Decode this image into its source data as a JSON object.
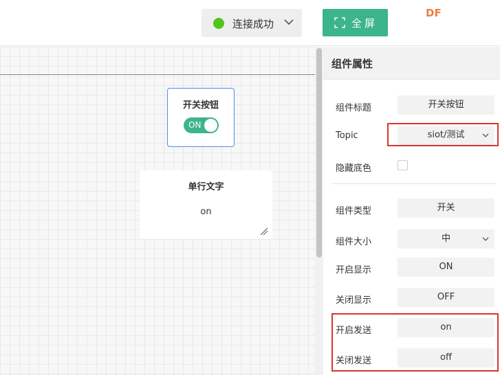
{
  "topbar": {
    "connection_label": "连接成功",
    "connection_status_color": "#52c41a",
    "fullscreen_label": "全屏",
    "brand": "DF"
  },
  "canvas": {
    "switch_widget": {
      "title": "开关按钮",
      "toggle_text": "ON",
      "state": "on"
    },
    "text_widget": {
      "title": "单行文字",
      "value": "on"
    }
  },
  "panel": {
    "title": "组件属性",
    "rows": {
      "title": {
        "label": "组件标题",
        "value": "开关按钮"
      },
      "topic": {
        "label": "Topic",
        "value": "siot/测试"
      },
      "hide_bg": {
        "label": "隐藏底色",
        "checked": false
      },
      "type": {
        "label": "组件类型",
        "value": "开关"
      },
      "size": {
        "label": "组件大小",
        "value": "中"
      },
      "on_display": {
        "label": "开启显示",
        "value": "ON"
      },
      "off_display": {
        "label": "关闭显示",
        "value": "OFF"
      },
      "on_send": {
        "label": "开启发送",
        "value": "on"
      },
      "off_send": {
        "label": "关闭发送",
        "value": "off"
      }
    }
  },
  "colors": {
    "accent": "#3cb48c",
    "highlight": "#d9332e",
    "selection_border": "#4a90e2"
  }
}
